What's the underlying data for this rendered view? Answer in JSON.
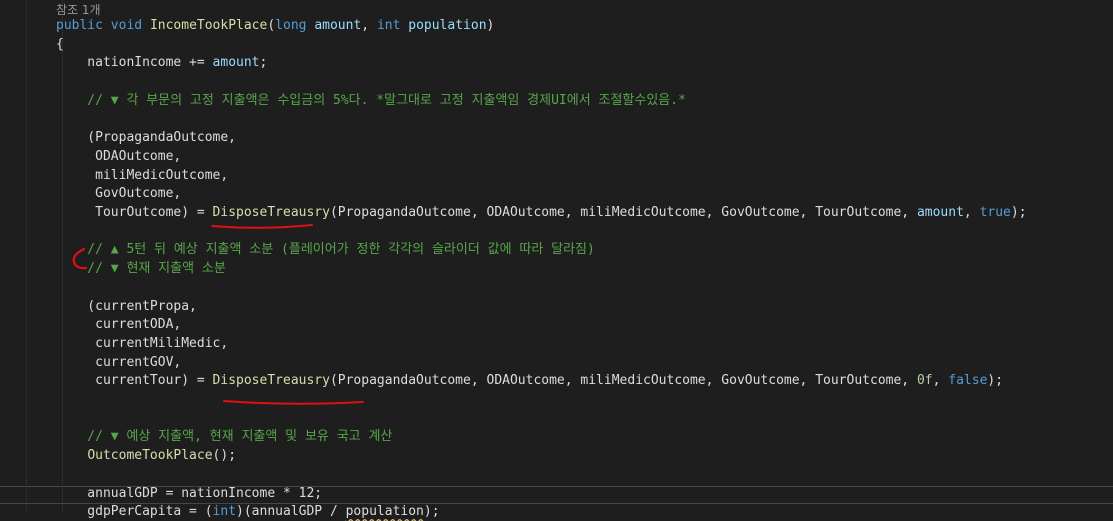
{
  "colors": {
    "background": "#1e1e1e",
    "default": "#dcdcdc",
    "keyword": "#569cd6",
    "method": "#dcdcaa",
    "parameter": "#9cdcfe",
    "comment": "#57a64a",
    "number": "#b5cea8",
    "codelens": "#999999",
    "annotation_ink": "#e01010"
  },
  "editor": {
    "codelens": "참조 1개",
    "lines": [
      [
        {
          "t": "public",
          "c": "keyword"
        },
        {
          "t": " "
        },
        {
          "t": "void",
          "c": "keyword"
        },
        {
          "t": " "
        },
        {
          "t": "IncomeTookPlace",
          "c": "method"
        },
        {
          "t": "("
        },
        {
          "t": "long",
          "c": "keyword"
        },
        {
          "t": " "
        },
        {
          "t": "amount",
          "c": "param"
        },
        {
          "t": ", "
        },
        {
          "t": "int",
          "c": "keyword"
        },
        {
          "t": " "
        },
        {
          "t": "population",
          "c": "param"
        },
        {
          "t": ")"
        }
      ],
      [
        {
          "t": "{"
        }
      ],
      [
        {
          "t": "    nationIncome += "
        },
        {
          "t": "amount",
          "c": "param"
        },
        {
          "t": ";"
        }
      ],
      [],
      [
        {
          "t": "    // ▼ 각 부문의 고정 지출액은 수입금의 5%다. *말그대로 고정 지출액임 경제UI에서 조절할수있음.*",
          "c": "comment"
        }
      ],
      [],
      [
        {
          "t": "    (PropagandaOutcome,"
        }
      ],
      [
        {
          "t": "     ODAOutcome,"
        }
      ],
      [
        {
          "t": "     miliMedicOutcome,"
        }
      ],
      [
        {
          "t": "     GovOutcome,"
        }
      ],
      [
        {
          "t": "     TourOutcome) = "
        },
        {
          "t": "DisposeTreausry",
          "c": "method"
        },
        {
          "t": "(PropagandaOutcome, ODAOutcome, miliMedicOutcome, GovOutcome, TourOutcome, "
        },
        {
          "t": "amount",
          "c": "param"
        },
        {
          "t": ", "
        },
        {
          "t": "true",
          "c": "keyword"
        },
        {
          "t": ");"
        }
      ],
      [],
      [
        {
          "t": "    // ▲ 5턴 뒤 예상 지출액 소분 (플레이어가 정한 각각의 슬라이더 값에 따라 달라짐)",
          "c": "comment"
        }
      ],
      [
        {
          "t": "    // ▼ 현재 지출액 소분",
          "c": "comment"
        }
      ],
      [],
      [
        {
          "t": "    (currentPropa,"
        }
      ],
      [
        {
          "t": "     currentODA,"
        }
      ],
      [
        {
          "t": "     currentMiliMedic,"
        }
      ],
      [
        {
          "t": "     currentGOV,"
        }
      ],
      [
        {
          "t": "     currentTour) = "
        },
        {
          "t": "DisposeTreausry",
          "c": "method"
        },
        {
          "t": "(PropagandaOutcome, ODAOutcome, miliMedicOutcome, GovOutcome, TourOutcome, "
        },
        {
          "t": "0f",
          "c": "number"
        },
        {
          "t": ", "
        },
        {
          "t": "false",
          "c": "keyword"
        },
        {
          "t": ");"
        }
      ],
      [],
      [],
      [
        {
          "t": "    // ▼ 예상 지출액, 현재 지출액 및 보유 국고 계산",
          "c": "comment"
        }
      ],
      [
        {
          "t": "    "
        },
        {
          "t": "OutcomeTookPlace",
          "c": "method"
        },
        {
          "t": "();"
        }
      ],
      [],
      [
        {
          "t": "    annualGDP = nationIncome * 12;"
        }
      ],
      [
        {
          "t": "    gdpPerCapita = ("
        },
        {
          "t": "int",
          "c": "keyword"
        },
        {
          "t": ")(annualGDP / "
        },
        {
          "t": "population",
          "c": "squiggle"
        },
        {
          "t": ");"
        }
      ]
    ]
  }
}
